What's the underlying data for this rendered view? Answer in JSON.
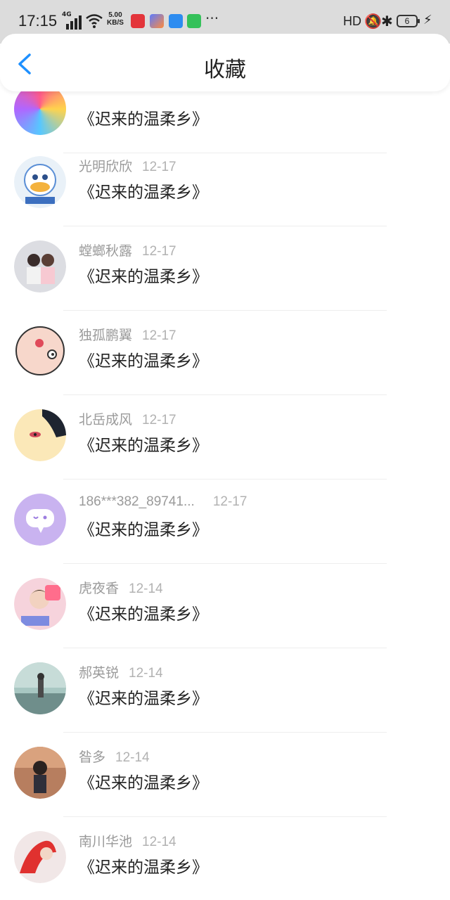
{
  "status_bar": {
    "time": "17:15",
    "network": "4G",
    "speed_top": "5.00",
    "speed_bottom": "KB/S",
    "more": "···",
    "hd": "HD",
    "battery": "6"
  },
  "header": {
    "title": "收藏"
  },
  "items": [
    {
      "name": "",
      "date": "",
      "subject": "《迟来的温柔乡》"
    },
    {
      "name": "光明欣欣",
      "date": "12-17",
      "subject": "《迟来的温柔乡》"
    },
    {
      "name": "螳螂秋露",
      "date": "12-17",
      "subject": "《迟来的温柔乡》"
    },
    {
      "name": "独孤鹏翼",
      "date": "12-17",
      "subject": "《迟来的温柔乡》"
    },
    {
      "name": "北岳成风",
      "date": "12-17",
      "subject": "《迟来的温柔乡》"
    },
    {
      "name": "186***382_89741...",
      "date": "12-17",
      "subject": "《迟来的温柔乡》"
    },
    {
      "name": "虎夜香",
      "date": "12-14",
      "subject": "《迟来的温柔乡》"
    },
    {
      "name": "郝英锐",
      "date": "12-14",
      "subject": "《迟来的温柔乡》"
    },
    {
      "name": "昝多",
      "date": "12-14",
      "subject": "《迟来的温柔乡》"
    },
    {
      "name": "南川华池",
      "date": "12-14",
      "subject": "《迟来的温柔乡》"
    }
  ]
}
